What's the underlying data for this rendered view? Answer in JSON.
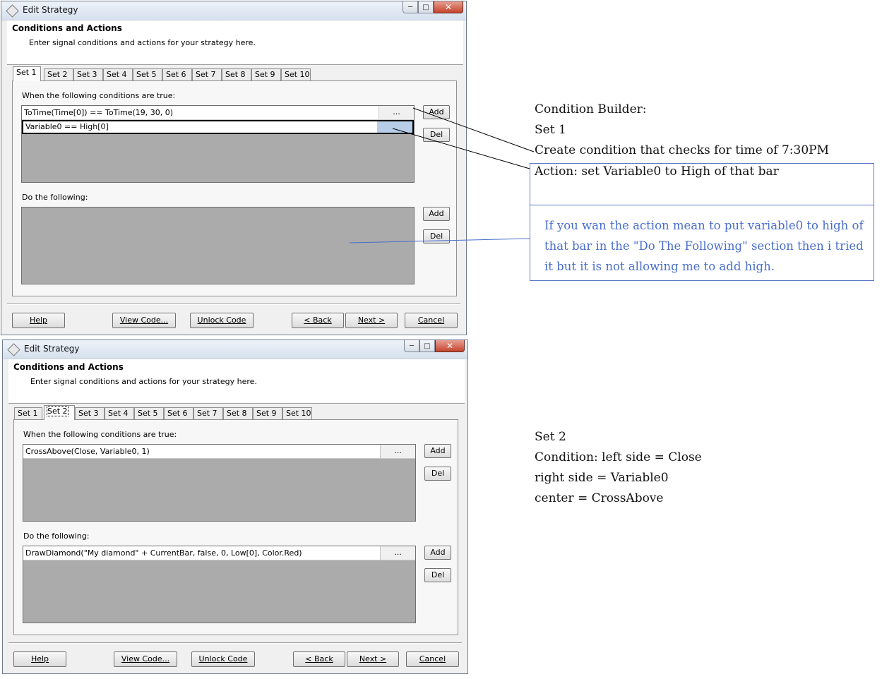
{
  "window1": {
    "title": "Edit Strategy",
    "header_title": "Conditions and Actions",
    "header_sub": "Enter signal conditions and actions for your strategy here.",
    "tabs": [
      "Set 1",
      "Set 2",
      "Set 3",
      "Set 4",
      "Set 5",
      "Set 6",
      "Set 7",
      "Set 8",
      "Set 9",
      "Set 10"
    ],
    "active_tab": "Set 1",
    "conditions_label": "When the following conditions are true:",
    "conditions": [
      {
        "text": "ToTime(Time[0]) == ToTime(19, 30, 0)",
        "button": "..."
      },
      {
        "text": "Variable0 == High[0]",
        "button": ""
      }
    ],
    "actions_label": "Do the following:",
    "actions": [],
    "add_label": "Add",
    "del_label": "Del",
    "footer": {
      "help": "Help",
      "view_code": "View Code...",
      "unlock_code": "Unlock Code",
      "back": "< Back",
      "next": "Next >",
      "cancel": "Cancel"
    }
  },
  "window2": {
    "title": "Edit Strategy",
    "header_title": "Conditions and Actions",
    "header_sub": "Enter signal conditions and actions for your strategy here.",
    "tabs": [
      "Set 1",
      "Set 2",
      "Set 3",
      "Set 4",
      "Set 5",
      "Set 6",
      "Set 7",
      "Set 8",
      "Set 9",
      "Set 10"
    ],
    "active_tab": "Set 2",
    "conditions_label": "When the following conditions are true:",
    "conditions": [
      {
        "text": "CrossAbove(Close, Variable0, 1)",
        "button": "..."
      }
    ],
    "actions_label": "Do the following:",
    "actions": [
      {
        "text": "DrawDiamond(\"My diamond\" + CurrentBar, false, 0, Low[0], Color.Red)",
        "button": "..."
      }
    ],
    "add_label": "Add",
    "del_label": "Del",
    "footer": {
      "help": "Help",
      "view_code": "View Code...",
      "unlock_code": "Unlock Code",
      "back": "< Back",
      "next": "Next >",
      "cancel": "Cancel"
    }
  },
  "notes1": {
    "line1": "Condition Builder:",
    "line2": "Set 1",
    "line3": "Create condition that checks for time of 7:30PM",
    "line4": "Action: set Variable0 to High of that bar",
    "reply": "If you wan the action mean to put variable0 to high of that bar in the \"Do The Following\" section then i tried it but it is not allowing me to add high."
  },
  "notes2": {
    "line1": "Set 2",
    "line2": "Condition: left side = Close",
    "line3": "right side = Variable0",
    "line4": "center = CrossAbove"
  },
  "colors": {
    "annotation_blue": "#4a6ecc",
    "list_gray": "#ababab",
    "selection_blue": "#b7cde8"
  }
}
